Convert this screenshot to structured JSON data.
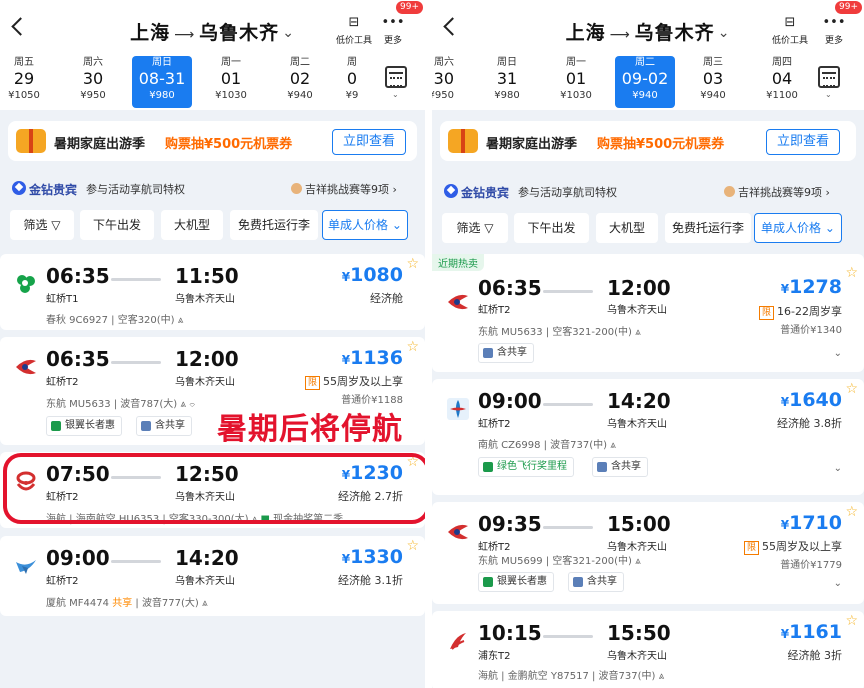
{
  "colors": {
    "accent": "#1a7cf0",
    "promo_orange": "#ff6a00",
    "annotation_red": "#e3132d",
    "background": "#eef2f7"
  },
  "left": {
    "header": {
      "from": "上海",
      "to": "乌鲁木齐",
      "tool_label": "低价工具",
      "more_label": "更多",
      "badge": "99+"
    },
    "dates": [
      {
        "wd": "周五",
        "d": "29",
        "p": "¥1050"
      },
      {
        "wd": "周六",
        "d": "30",
        "p": "¥950"
      },
      {
        "wd": "周日",
        "d": "08-31",
        "p": "¥980"
      },
      {
        "wd": "周一",
        "d": "01",
        "p": "¥1030"
      },
      {
        "wd": "周二",
        "d": "02",
        "p": "¥940"
      },
      {
        "wd": "周",
        "d": "0",
        "p": "¥9"
      }
    ],
    "banner": {
      "title": "暑期家庭出游季",
      "offer": "购票抽¥500元机票券",
      "button": "立即查看"
    },
    "member": {
      "name": "金钻贵宾",
      "desc": "参与活动享航司特权",
      "right": "吉祥挑战赛等9项 ›"
    },
    "filters": [
      "筛选",
      "下午出发",
      "大机型",
      "免费托运行李",
      "单成人价格"
    ],
    "flights": [
      {
        "dep": "06:35",
        "dep_ap": "虹桥T1",
        "arr": "11:50",
        "arr_ap": "乌鲁木齐天山",
        "price": "1080",
        "cabin": "经济舱",
        "meta": "春秋 9C6927 | 空客320(中)"
      },
      {
        "dep": "06:35",
        "dep_ap": "虹桥T2",
        "arr": "12:00",
        "arr_ap": "乌鲁木齐天山",
        "price": "1136",
        "limit_tag": "限",
        "cabin": "55周岁及以上享",
        "regular": "普通价¥1188",
        "meta": "东航 MU5633 | 波音787(大)",
        "tags": [
          "银翼长者惠",
          "含共享"
        ]
      },
      {
        "dep": "07:50",
        "dep_ap": "虹桥T2",
        "arr": "12:50",
        "arr_ap": "乌鲁木齐天山",
        "price": "1230",
        "cabin": "经济舱 2.7折",
        "meta": "海航 | 海南航空 HU6353 | 空客330-300(大)",
        "promo": "现金抽奖第二季"
      },
      {
        "dep": "09:00",
        "dep_ap": "虹桥T2",
        "arr": "14:20",
        "arr_ap": "乌鲁木齐天山",
        "price": "1330",
        "cabin": "经济舱 3.1折",
        "meta_a": "厦航 MF4474",
        "meta_share": "共享",
        "meta_b": "波音777(大)"
      }
    ],
    "annotation": "暑期后将停航"
  },
  "right": {
    "header": {
      "from": "上海",
      "to": "乌鲁木齐",
      "tool_label": "低价工具",
      "more_label": "更多",
      "badge": "99+"
    },
    "dates": [
      {
        "wd": "周六",
        "d": "30",
        "p": "¥950"
      },
      {
        "wd": "周日",
        "d": "31",
        "p": "¥980"
      },
      {
        "wd": "周一",
        "d": "01",
        "p": "¥1030"
      },
      {
        "wd": "周二",
        "d": "09-02",
        "p": "¥940"
      },
      {
        "wd": "周三",
        "d": "03",
        "p": "¥940"
      },
      {
        "wd": "周四",
        "d": "04",
        "p": "¥1100"
      }
    ],
    "banner": {
      "title": "暑期家庭出游季",
      "offer": "购票抽¥500元机票券",
      "button": "立即查看"
    },
    "member": {
      "name": "金钻贵宾",
      "desc": "参与活动享航司特权",
      "right": "吉祥挑战赛等9项 ›"
    },
    "filters": [
      "筛选",
      "下午出发",
      "大机型",
      "免费托运行李",
      "单成人价格"
    ],
    "flights": [
      {
        "hot": "近期热卖",
        "dep": "06:35",
        "dep_ap": "虹桥T2",
        "arr": "12:00",
        "arr_ap": "乌鲁木齐天山",
        "price": "1278",
        "limit_tag": "限",
        "cabin": "16-22周岁享",
        "regular": "普通价¥1340",
        "meta": "东航 MU5633 | 空客321-200(中)",
        "tags": [
          "含共享"
        ]
      },
      {
        "dep": "09:00",
        "dep_ap": "虹桥T2",
        "arr": "14:20",
        "arr_ap": "乌鲁木齐天山",
        "price": "1640",
        "cabin": "经济舱 3.8折",
        "meta": "南航 CZ6998 | 波音737(中)",
        "tags": [
          "绿色飞行奖里程",
          "含共享"
        ]
      },
      {
        "dep": "09:35",
        "dep_ap": "虹桥T2",
        "arr": "15:00",
        "arr_ap": "乌鲁木齐天山",
        "price": "1710",
        "limit_tag": "限",
        "cabin": "55周岁及以上享",
        "regular": "普通价¥1779",
        "meta": "东航 MU5699 | 空客321-200(中)",
        "tags": [
          "银翼长者惠",
          "含共享"
        ]
      },
      {
        "dep": "10:15",
        "dep_ap": "浦东T2",
        "arr": "15:50",
        "arr_ap": "乌鲁木齐天山",
        "price": "1161",
        "cabin": "经济舱 3折",
        "meta": "海航 | 金鹏航空 Y87517 | 波音737(中)"
      }
    ]
  }
}
